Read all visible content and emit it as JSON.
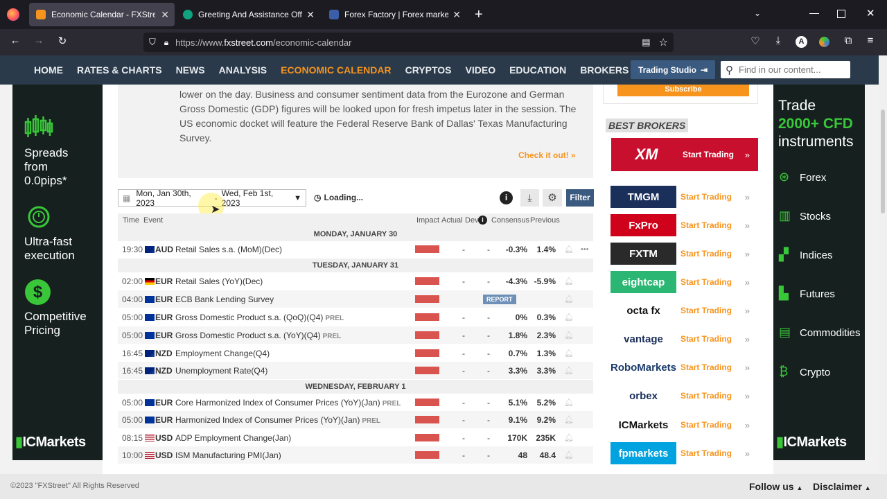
{
  "browser": {
    "tabs": [
      {
        "title": "Economic Calendar - FXStreet",
        "active": true
      },
      {
        "title": "Greeting And Assistance Offer",
        "active": false
      },
      {
        "title": "Forex Factory | Forex markets fo",
        "active": false
      }
    ],
    "new_tab": "+",
    "url_prefix": "https://www.",
    "url_domain": "fxstreet.com",
    "url_path": "/economic-calendar",
    "profile_initial": "A"
  },
  "site_nav": {
    "items": [
      "HOME",
      "RATES & CHARTS",
      "NEWS",
      "ANALYSIS",
      "ECONOMIC CALENDAR",
      "CRYPTOS",
      "VIDEO",
      "EDUCATION",
      "BROKERS"
    ],
    "active_index": 4,
    "trading_studio": "Trading Studio",
    "search_placeholder": "Find in our content..."
  },
  "left_ad": {
    "features": [
      {
        "icon": "candlestick-icon",
        "text": "Spreads from 0.0pips*"
      },
      {
        "icon": "stopwatch-icon",
        "text": "Ultra-fast execution"
      },
      {
        "icon": "dollar-icon",
        "text": "Competitive Pricing"
      }
    ],
    "brand": "ICMarkets"
  },
  "intro": {
    "text": "lower on the day. Business and consumer sentiment data from the Eurozone and German Gross Domestic (GDP) figures will be looked upon for fresh impetus later in the session. The US economic docket will feature the Federal Reserve Bank of Dallas' Texas Manufacturing Survey.",
    "cta": "Check it out!"
  },
  "controls": {
    "date_range_start": "Mon, Jan 30th, 2023",
    "date_range_sep": "-",
    "date_range_end": "Wed, Feb 1st, 2023",
    "loading": "Loading...",
    "filter": "Filter"
  },
  "table": {
    "headers": {
      "time": "Time",
      "event": "Event",
      "impact": "Impact",
      "actual": "Actual",
      "dev": "Dev",
      "consensus": "Consensus",
      "previous": "Previous"
    },
    "days": [
      {
        "label": "MONDAY, JANUARY 30",
        "rows": [
          {
            "time": "19:30",
            "flag": "au",
            "cur": "AUD",
            "event": "Retail Sales s.a. (MoM)(Dec)",
            "prel": "",
            "actual": "-",
            "dev": "-",
            "consensus": "-0.3%",
            "previous": "1.4%",
            "report": ""
          }
        ]
      },
      {
        "label": "TUESDAY, JANUARY 31",
        "rows": [
          {
            "time": "02:00",
            "flag": "de",
            "cur": "EUR",
            "event": "Retail Sales (YoY)(Dec)",
            "prel": "",
            "actual": "-",
            "dev": "-",
            "consensus": "-4.3%",
            "previous": "-5.9%",
            "report": ""
          },
          {
            "time": "04:00",
            "flag": "eu",
            "cur": "EUR",
            "event": "ECB Bank Lending Survey",
            "prel": "",
            "actual": "",
            "dev": "",
            "consensus": "",
            "previous": "",
            "report": "REPORT"
          },
          {
            "time": "05:00",
            "flag": "eu",
            "cur": "EUR",
            "event": "Gross Domestic Product s.a. (QoQ)(Q4)",
            "prel": "PREL",
            "actual": "-",
            "dev": "-",
            "consensus": "0%",
            "previous": "0.3%",
            "report": ""
          },
          {
            "time": "05:00",
            "flag": "eu",
            "cur": "EUR",
            "event": "Gross Domestic Product s.a. (YoY)(Q4)",
            "prel": "PREL",
            "actual": "-",
            "dev": "-",
            "consensus": "1.8%",
            "previous": "2.3%",
            "report": ""
          },
          {
            "time": "16:45",
            "flag": "nz",
            "cur": "NZD",
            "event": "Employment Change(Q4)",
            "prel": "",
            "actual": "-",
            "dev": "-",
            "consensus": "0.7%",
            "previous": "1.3%",
            "report": ""
          },
          {
            "time": "16:45",
            "flag": "nz",
            "cur": "NZD",
            "event": "Unemployment Rate(Q4)",
            "prel": "",
            "actual": "-",
            "dev": "-",
            "consensus": "3.3%",
            "previous": "3.3%",
            "report": ""
          }
        ]
      },
      {
        "label": "WEDNESDAY, FEBRUARY 1",
        "rows": [
          {
            "time": "05:00",
            "flag": "eu",
            "cur": "EUR",
            "event": "Core Harmonized Index of Consumer Prices (YoY)(Jan)",
            "prel": "PREL",
            "actual": "-",
            "dev": "-",
            "consensus": "5.1%",
            "previous": "5.2%",
            "report": ""
          },
          {
            "time": "05:00",
            "flag": "eu",
            "cur": "EUR",
            "event": "Harmonized Index of Consumer Prices (YoY)(Jan)",
            "prel": "PREL",
            "actual": "-",
            "dev": "-",
            "consensus": "9.1%",
            "previous": "9.2%",
            "report": ""
          },
          {
            "time": "08:15",
            "flag": "us",
            "cur": "USD",
            "event": "ADP Employment Change(Jan)",
            "prel": "",
            "actual": "-",
            "dev": "-",
            "consensus": "170K",
            "previous": "235K",
            "report": ""
          },
          {
            "time": "10:00",
            "flag": "us",
            "cur": "USD",
            "event": "ISM Manufacturing PMI(Jan)",
            "prel": "",
            "actual": "-",
            "dev": "-",
            "consensus": "48",
            "previous": "48.4",
            "report": ""
          }
        ]
      }
    ]
  },
  "sidebar": {
    "subscribe": "Subscribe",
    "best_brokers": "BEST BROKERS",
    "cta": "Start Trading",
    "brokers": [
      {
        "name": "XM",
        "bg": "#c8102e",
        "fg": "#ffffff"
      },
      {
        "name": "TMGM",
        "bg": "#1a2f5a",
        "fg": "#ffffff"
      },
      {
        "name": "FxPro",
        "bg": "#d0021b",
        "fg": "#ffffff"
      },
      {
        "name": "FXTM",
        "bg": "#2a2a2a",
        "fg": "#ffffff"
      },
      {
        "name": "eightcap",
        "bg": "#2bb673",
        "fg": "#ffffff"
      },
      {
        "name": "octa fx",
        "bg": "#ffffff",
        "fg": "#111111"
      },
      {
        "name": "vantage",
        "bg": "#ffffff",
        "fg": "#1a2f5a"
      },
      {
        "name": "RoboMarkets",
        "bg": "#ffffff",
        "fg": "#1a3a6a"
      },
      {
        "name": "orbex",
        "bg": "#ffffff",
        "fg": "#1a2f5a"
      },
      {
        "name": "ICMarkets",
        "bg": "#ffffff",
        "fg": "#111111"
      },
      {
        "name": "fpmarkets",
        "bg": "#00a3e0",
        "fg": "#ffffff"
      }
    ]
  },
  "right_ad": {
    "line1": "Trade",
    "line2": "2000+ CFD",
    "line3": "instruments",
    "items": [
      "Forex",
      "Stocks",
      "Indices",
      "Futures",
      "Commodities",
      "Crypto"
    ],
    "brand": "ICMarkets"
  },
  "footer": {
    "copyright": "©2023 \"FXStreet\" All Rights Reserved",
    "follow_us": "Follow us",
    "disclaimer": "Disclaimer"
  },
  "colors": {
    "accent": "#f7941d",
    "nav_bg": "#2a3a4a",
    "impact_high": "#d9534f",
    "ad_green": "#39c739"
  }
}
